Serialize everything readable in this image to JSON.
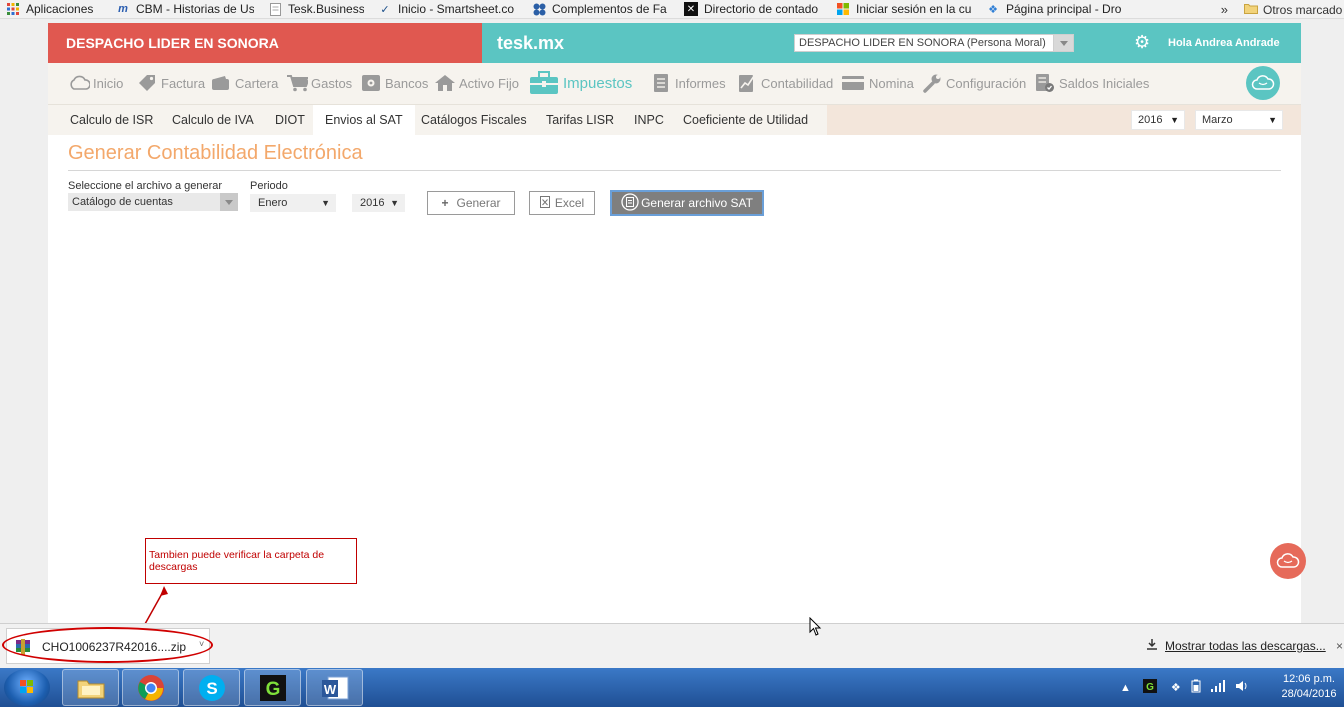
{
  "bookmarks": {
    "items": [
      {
        "label": "Aplicaciones",
        "icon": "apps-grid-icon"
      },
      {
        "label": "CBM - Historias de Us",
        "icon": "m-logo-icon"
      },
      {
        "label": "Tesk.Business",
        "icon": "page-icon"
      },
      {
        "label": "Inicio - Smartsheet.co",
        "icon": "check-icon"
      },
      {
        "label": "Complementos de Fa",
        "icon": "clover-icon"
      },
      {
        "label": "Directorio de contado",
        "icon": "x-logo-icon"
      },
      {
        "label": "Iniciar sesión en la cu",
        "icon": "windows-logo-icon"
      },
      {
        "label": "Página principal - Dro",
        "icon": "dropbox-icon"
      }
    ],
    "overflow": "»",
    "other": "Otros marcado"
  },
  "header": {
    "company": "DESPACHO LIDER EN SONORA",
    "brand": "tesk.mx",
    "company_select": "DESPACHO LIDER EN SONORA (Persona Moral)",
    "greeting": "Hola Andrea Andrade"
  },
  "nav": {
    "items": [
      {
        "label": "Inicio",
        "icon": "cloud-icon"
      },
      {
        "label": "Factura",
        "icon": "tag-icon"
      },
      {
        "label": "Cartera",
        "icon": "wallet-icon"
      },
      {
        "label": "Gastos",
        "icon": "cart-icon"
      },
      {
        "label": "Bancos",
        "icon": "safe-icon"
      },
      {
        "label": "Activo Fijo",
        "icon": "house-icon"
      },
      {
        "label": "Impuestos",
        "icon": "briefcase-icon"
      },
      {
        "label": "Informes",
        "icon": "document-icon"
      },
      {
        "label": "Contabilidad",
        "icon": "chart-doc-icon"
      },
      {
        "label": "Nomina",
        "icon": "card-icon"
      },
      {
        "label": "Configuración",
        "icon": "wrench-icon"
      },
      {
        "label": "Saldos Iniciales",
        "icon": "doc-check-icon"
      }
    ]
  },
  "subnav": {
    "items": [
      "Calculo de ISR",
      "Calculo de IVA",
      "DIOT",
      "Envios al SAT",
      "Catálogos Fiscales",
      "Tarifas LISR",
      "INPC",
      "Coeficiente de Utilidad"
    ],
    "year": "2016",
    "month": "Marzo"
  },
  "main": {
    "title": "Generar Contabilidad Electrónica",
    "file_label": "Seleccione el archivo a generar",
    "file_value": "Catálogo de cuentas",
    "period_label": "Periodo",
    "period_month": "Enero",
    "period_year": "2016",
    "generate_btn": "Generar",
    "excel_btn": "Excel",
    "sat_btn": "Generar archivo SAT"
  },
  "annotation": "Tambien puede verificar la carpeta  de descargas",
  "downloads": {
    "file": "CHO1006237R42016....zip",
    "show_all": "Mostrar todas las descargas..."
  },
  "taskbar": {
    "time": "12:06 p.m.",
    "date": "28/04/2016"
  },
  "colors": {
    "header_red": "#e05850",
    "brand_teal": "#5bc5c2",
    "title_orange": "#f3a86b",
    "annotation_red": "#c00000"
  }
}
